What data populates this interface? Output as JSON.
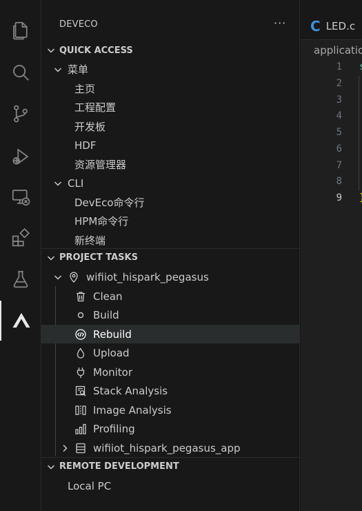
{
  "sidebar": {
    "title": "DEVECO",
    "more": "···",
    "quick_access": {
      "header": "QUICK ACCESS",
      "menu": {
        "label": "菜单",
        "items": [
          "主页",
          "工程配置",
          "开发板",
          "HDF",
          "资源管理器"
        ]
      },
      "cli": {
        "label": "CLI",
        "items": [
          "DevEco命令行",
          "HPM命令行",
          "新终端"
        ]
      }
    },
    "project_tasks": {
      "header": "PROJECT TASKS",
      "project": "wifiiot_hispark_pegasus",
      "tasks": [
        {
          "label": "Clean",
          "icon": "trash-icon"
        },
        {
          "label": "Build",
          "icon": "circle-icon"
        },
        {
          "label": "Rebuild",
          "icon": "code-icon"
        },
        {
          "label": "Upload",
          "icon": "flame-icon"
        },
        {
          "label": "Monitor",
          "icon": "plug-icon"
        },
        {
          "label": "Stack Analysis",
          "icon": "stack-analysis-icon"
        },
        {
          "label": "Image Analysis",
          "icon": "image-analysis-icon"
        },
        {
          "label": "Profiling",
          "icon": "bar-chart-icon"
        }
      ],
      "app": "wifiiot_hispark_pegasus_app",
      "selected": "Rebuild"
    },
    "remote_development": {
      "header": "REMOTE DEVELOPMENT",
      "items": [
        "Local PC"
      ]
    }
  },
  "editor": {
    "tab": {
      "icon_letter": "C",
      "label": "LED.c"
    },
    "breadcrumb": "application",
    "line_numbers": [
      "1",
      "2",
      "3",
      "4",
      "5",
      "6",
      "7",
      "8",
      "9"
    ],
    "active_line": "9",
    "code_first_char": "s",
    "code_last_char": "}"
  },
  "colors": {
    "background": "#181818",
    "editor_background": "#1f1f1f",
    "selected_row": "#2a2d2e",
    "c_icon": "#3c91d8",
    "bracket_yellow": "#ffd700",
    "string_green": "#4ec9b0"
  }
}
